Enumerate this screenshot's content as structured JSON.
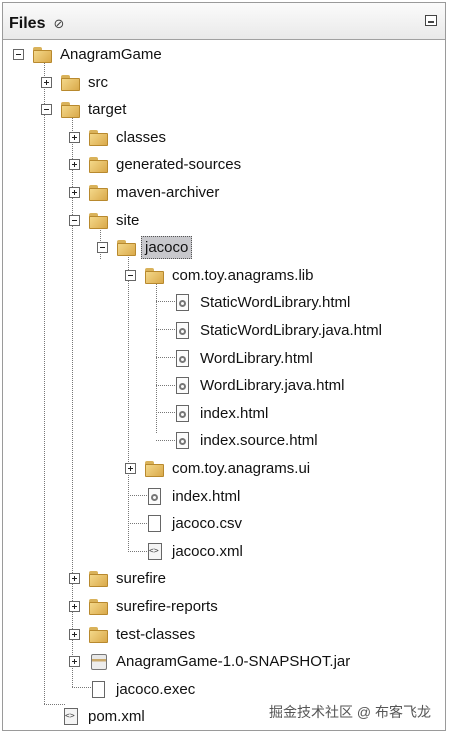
{
  "panel": {
    "tab_label": "Files",
    "tab_close_glyph": "⊘"
  },
  "tree": [
    {
      "id": "anagramgame",
      "label": "AnagramGame",
      "icon": "folder-icon",
      "toggle": "expanded"
    },
    {
      "id": "src",
      "label": "src",
      "icon": "folder-icon",
      "toggle": "collapsed"
    },
    {
      "id": "target",
      "label": "target",
      "icon": "folder-icon",
      "toggle": "expanded"
    },
    {
      "id": "classes",
      "label": "classes",
      "icon": "folder-icon",
      "toggle": "collapsed"
    },
    {
      "id": "generated-sources",
      "label": "generated-sources",
      "icon": "folder-icon",
      "toggle": "collapsed"
    },
    {
      "id": "maven-archiver",
      "label": "maven-archiver",
      "icon": "folder-icon",
      "toggle": "collapsed"
    },
    {
      "id": "site",
      "label": "site",
      "icon": "folder-icon",
      "toggle": "expanded"
    },
    {
      "id": "jacoco",
      "label": "jacoco",
      "icon": "folder-icon",
      "toggle": "expanded",
      "selected": true
    },
    {
      "id": "com-toy-anagrams-lib",
      "label": "com.toy.anagrams.lib",
      "icon": "folder-icon",
      "toggle": "expanded"
    },
    {
      "id": "staticwordlibrary-html",
      "label": "StaticWordLibrary.html",
      "icon": "html-file-icon"
    },
    {
      "id": "staticwordlibrary-java-html",
      "label": "StaticWordLibrary.java.html",
      "icon": "html-file-icon"
    },
    {
      "id": "wordlibrary-html",
      "label": "WordLibrary.html",
      "icon": "html-file-icon"
    },
    {
      "id": "wordlibrary-java-html",
      "label": "WordLibrary.java.html",
      "icon": "html-file-icon"
    },
    {
      "id": "index-html-lib",
      "label": "index.html",
      "icon": "html-file-icon"
    },
    {
      "id": "index-source-html",
      "label": "index.source.html",
      "icon": "html-file-icon"
    },
    {
      "id": "com-toy-anagrams-ui",
      "label": "com.toy.anagrams.ui",
      "icon": "folder-icon",
      "toggle": "collapsed"
    },
    {
      "id": "index-html-jacoco",
      "label": "index.html",
      "icon": "html-file-icon"
    },
    {
      "id": "jacoco-csv",
      "label": "jacoco.csv",
      "icon": "file-icon"
    },
    {
      "id": "jacoco-xml",
      "label": "jacoco.xml",
      "icon": "xml-file-icon"
    },
    {
      "id": "surefire",
      "label": "surefire",
      "icon": "folder-icon",
      "toggle": "collapsed"
    },
    {
      "id": "surefire-reports",
      "label": "surefire-reports",
      "icon": "folder-icon",
      "toggle": "collapsed"
    },
    {
      "id": "test-classes",
      "label": "test-classes",
      "icon": "folder-icon",
      "toggle": "collapsed"
    },
    {
      "id": "jar",
      "label": "AnagramGame-1.0-SNAPSHOT.jar",
      "icon": "jar-file-icon",
      "toggle": "collapsed"
    },
    {
      "id": "jacoco-exec",
      "label": "jacoco.exec",
      "icon": "file-icon"
    },
    {
      "id": "pom-xml",
      "label": "pom.xml",
      "icon": "xml-file-icon"
    }
  ],
  "watermark": "掘金技术社区 @ 布客飞龙"
}
